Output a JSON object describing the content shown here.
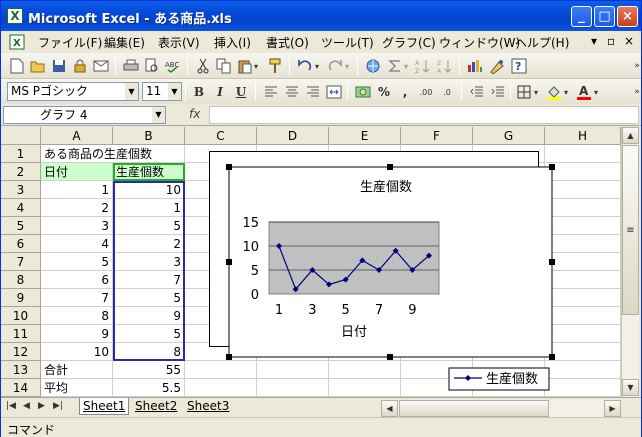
{
  "window": {
    "title": "Microsoft Excel - ある商品.xls",
    "app_icon": "X",
    "min_label": "_",
    "max_label": "□",
    "close_label": "×"
  },
  "menu": [
    "ファイル(F)",
    "編集(E)",
    "表示(V)",
    "挿入(I)",
    "書式(O)",
    "ツール(T)",
    "グラフ(C)",
    "ウィンドウ(W)",
    "ヘルプ(H)"
  ],
  "menu_controls": {
    "minimize": "▾",
    "restore": "▫",
    "close": "×"
  },
  "format_bar": {
    "font_name": "MS Pゴシック",
    "font_size": "11",
    "bold": "B",
    "italic": "I",
    "underline": "U"
  },
  "formula_bar": {
    "name_box": "グラフ 4",
    "fx": "fx",
    "formula": ""
  },
  "columns": [
    "A",
    "B",
    "C",
    "D",
    "E",
    "F",
    "G",
    "H"
  ],
  "rows": [
    {
      "n": "1",
      "a": "ある商品の生産個数",
      "b": ""
    },
    {
      "n": "2",
      "a": "日付",
      "b": "生産個数"
    },
    {
      "n": "3",
      "a": "1",
      "b": "10"
    },
    {
      "n": "4",
      "a": "2",
      "b": "1"
    },
    {
      "n": "5",
      "a": "3",
      "b": "5"
    },
    {
      "n": "6",
      "a": "4",
      "b": "2"
    },
    {
      "n": "7",
      "a": "5",
      "b": "3"
    },
    {
      "n": "8",
      "a": "6",
      "b": "7"
    },
    {
      "n": "9",
      "a": "7",
      "b": "5"
    },
    {
      "n": "10",
      "a": "8",
      "b": "9"
    },
    {
      "n": "11",
      "a": "9",
      "b": "5"
    },
    {
      "n": "12",
      "a": "10",
      "b": "8"
    },
    {
      "n": "13",
      "a": "合計",
      "b": "55"
    },
    {
      "n": "14",
      "a": "平均",
      "b": "5.5"
    }
  ],
  "sheets": [
    "Sheet1",
    "Sheet2",
    "Sheet3"
  ],
  "status": "コマンド",
  "chart_data": {
    "type": "line",
    "title": "生産個数",
    "xlabel": "日付",
    "ylabel": "",
    "x": [
      1,
      2,
      3,
      4,
      5,
      6,
      7,
      8,
      9,
      10
    ],
    "x_tick_labels": [
      "1",
      "3",
      "5",
      "7",
      "9"
    ],
    "y_ticks": [
      "0",
      "5",
      "10",
      "15"
    ],
    "ylim": [
      0,
      15
    ],
    "grid": true,
    "legend_position": "right",
    "series": [
      {
        "name": "生産個数",
        "values": [
          10,
          1,
          5,
          2,
          3,
          7,
          5,
          9,
          5,
          8
        ],
        "color": "#000080"
      }
    ],
    "plot_area_color": "#c0c0c0"
  }
}
